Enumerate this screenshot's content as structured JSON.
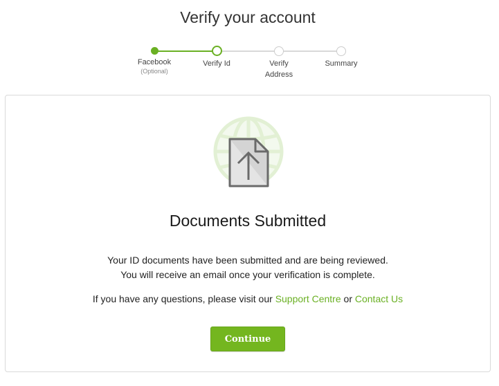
{
  "page": {
    "title": "Verify your account"
  },
  "stepper": {
    "steps": [
      {
        "label": "Facebook",
        "sublabel": "(Optional)",
        "state": "complete"
      },
      {
        "label": "Verify Id",
        "sublabel": "",
        "state": "current"
      },
      {
        "label": "Verify Address",
        "sublabel": "",
        "state": "pending"
      },
      {
        "label": "Summary",
        "sublabel": "",
        "state": "pending"
      }
    ]
  },
  "card": {
    "icon": "document-upload-globe-icon",
    "heading": "Documents Submitted",
    "message_line1": "Your ID documents have been submitted and are being reviewed.",
    "message_line2": "You will receive an email once your verification is complete.",
    "help_prefix": "If you have any questions, please visit our ",
    "support_link": "Support Centre",
    "help_or": " or ",
    "contact_link": "Contact Us",
    "continue_label": "Continue"
  },
  "colors": {
    "accent": "#6ab023",
    "button": "#74b61f",
    "pending": "#cccccc"
  }
}
